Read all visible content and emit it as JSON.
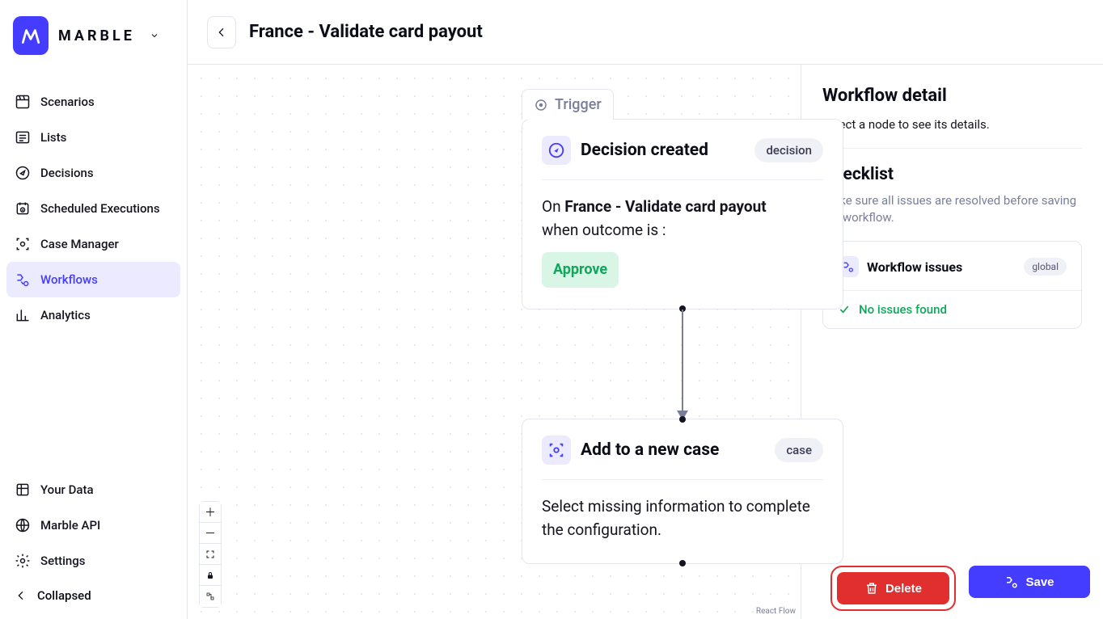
{
  "brand": {
    "wordmark": "MARBLE"
  },
  "nav": {
    "primary": [
      {
        "label": "Scenarios",
        "key": "scenarios"
      },
      {
        "label": "Lists",
        "key": "lists"
      },
      {
        "label": "Decisions",
        "key": "decisions"
      },
      {
        "label": "Scheduled Executions",
        "key": "scheduled"
      },
      {
        "label": "Case Manager",
        "key": "case-manager"
      },
      {
        "label": "Workflows",
        "key": "workflows",
        "active": true
      },
      {
        "label": "Analytics",
        "key": "analytics"
      }
    ],
    "secondary": [
      {
        "label": "Your Data",
        "key": "your-data"
      },
      {
        "label": "Marble API",
        "key": "api"
      },
      {
        "label": "Settings",
        "key": "settings"
      }
    ],
    "collapse_label": "Collapsed"
  },
  "header": {
    "title": "France - Validate card payout"
  },
  "canvas": {
    "trigger_label": "Trigger",
    "attribution": "React Flow",
    "node1": {
      "title": "Decision created",
      "tag": "decision",
      "body_prefix": "On ",
      "body_bold": "France - Validate card payout",
      "body_line2": "when outcome is :",
      "outcome_pill": "Approve"
    },
    "node2": {
      "title": "Add to a new case",
      "tag": "case",
      "body": "Select missing information to complete the configuration."
    }
  },
  "rpanel": {
    "title": "Workflow detail",
    "help": "Select a node to see its details.",
    "checklist_title": "Checklist",
    "checklist_help": "Make sure all issues are resolved before saving the workflow.",
    "issues_card": {
      "title": "Workflow issues",
      "tag": "global",
      "status": "No issues found"
    }
  },
  "footer": {
    "delete_label": "Delete",
    "save_label": "Save"
  }
}
